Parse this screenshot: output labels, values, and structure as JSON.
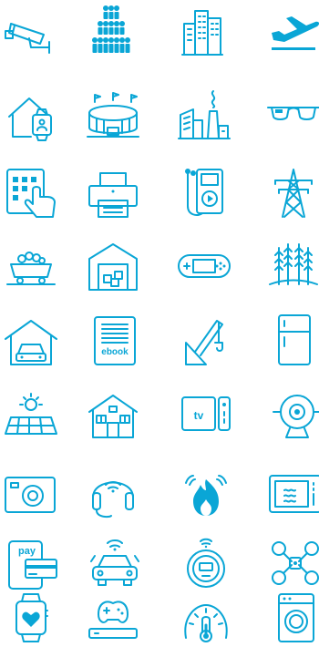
{
  "accent_color": "#0aa6d6",
  "icons": [
    [
      "security-camera-icon",
      "crowd-population-icon",
      "city-buildings-icon",
      "airplane-takeoff-icon"
    ],
    [
      "smart-home-watch-icon",
      "stadium-icon",
      "factory-icon",
      "smart-glasses-icon"
    ],
    [
      "tablet-touch-icon",
      "printer-icon",
      "media-player-icon",
      "power-tower-icon"
    ],
    [
      "mining-cart-icon",
      "warehouse-icon",
      "handheld-console-icon",
      "wheat-field-icon"
    ],
    [
      "garage-car-icon",
      "ebook-reader-icon",
      "crane-icon",
      "refrigerator-icon"
    ],
    [
      "solar-panel-icon",
      "house-icon",
      "tv-box-icon",
      "webcam-icon"
    ],
    [
      "camera-icon",
      "headset-icon",
      "fire-alarm-icon",
      "microwave-icon"
    ],
    [
      "mobile-payment-icon",
      "connected-car-icon",
      "robot-vacuum-icon",
      "drone-icon"
    ],
    [
      "smartwatch-heart-icon",
      "game-console-icon",
      "thermometer-gauge-icon",
      "washing-machine-icon"
    ]
  ],
  "labels": {
    "tv": "tv",
    "ebook": "ebook",
    "pay": "pay"
  }
}
